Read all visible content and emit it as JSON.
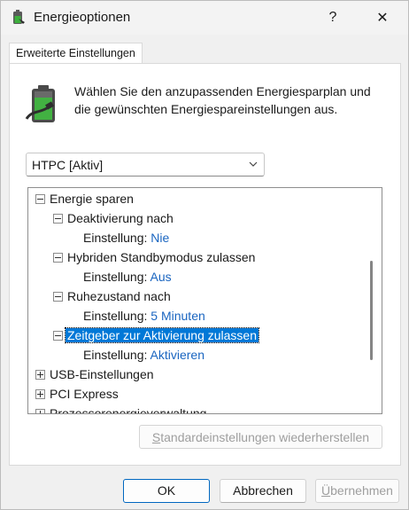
{
  "window": {
    "title": "Energieoptionen",
    "help": "?",
    "close": "✕"
  },
  "tab": {
    "label": "Erweiterte Einstellungen"
  },
  "description": "Wählen Sie den anzupassenden Energiesparplan und die gewünschten Energiespareinstellungen aus.",
  "plan_select": {
    "value": "HTPC [Aktiv]"
  },
  "tree": {
    "energie_sparen": "Energie sparen",
    "deaktivierung": {
      "label": "Deaktivierung nach",
      "setting_label": "Einstellung:",
      "setting_value": "Nie"
    },
    "hybrid": {
      "label": "Hybriden Standbymodus zulassen",
      "setting_label": "Einstellung:",
      "setting_value": "Aus"
    },
    "ruhezustand": {
      "label": "Ruhezustand nach",
      "setting_label": "Einstellung:",
      "setting_value": "5 Minuten"
    },
    "zeitgeber": {
      "label": "Zeitgeber zur Aktivierung zulassen",
      "setting_label": "Einstellung:",
      "setting_value": "Aktivieren"
    },
    "usb": "USB-Einstellungen",
    "pci": "PCI Express",
    "prozessor": "Prozessorenergieverwaltung"
  },
  "buttons": {
    "restore_pre": "S",
    "restore_rest": "tandardeinstellungen wiederherstellen",
    "ok": "OK",
    "cancel": "Abbrechen",
    "apply_pre": "Ü",
    "apply_rest": "bernehmen"
  }
}
